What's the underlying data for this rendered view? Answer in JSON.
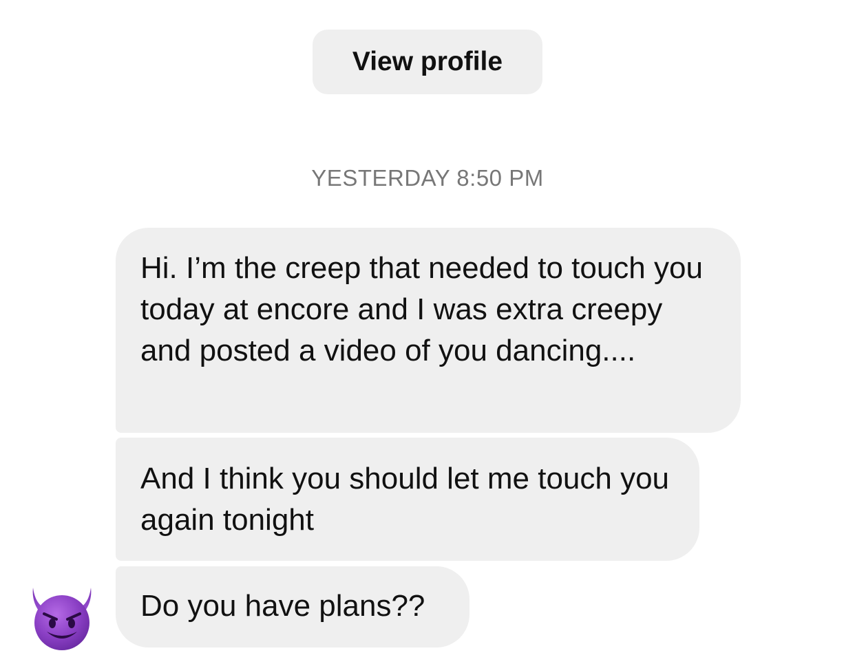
{
  "header": {
    "view_profile_label": "View profile"
  },
  "thread": {
    "timestamp": "YESTERDAY 8:50 PM",
    "messages": [
      {
        "text": "Hi. I’m the creep that needed to touch you today at encore and I was extra creepy and posted a video of you dancing...."
      },
      {
        "text": "And I think you should let me touch you again tonight"
      },
      {
        "text": "Do you have plans??"
      }
    ],
    "sender_avatar_icon": "smiling-devil-emoji-icon"
  },
  "colors": {
    "bubble_bg": "#efefef",
    "timestamp_text": "#777777",
    "avatar_purple": "#8a3fc4"
  }
}
